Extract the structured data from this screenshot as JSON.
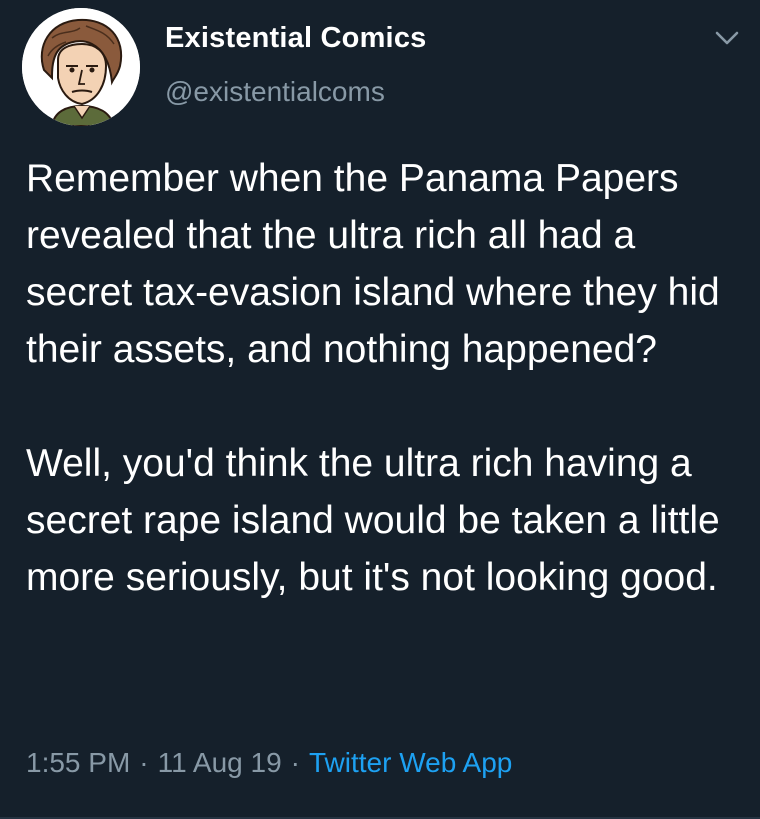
{
  "author": {
    "display_name": "Existential Comics",
    "handle": "@existentialcoms",
    "avatar_icon": "cartoon-portrait-avatar"
  },
  "tweet": {
    "paragraphs": [
      "Remember when the Panama Papers revealed that the ultra rich all had a secret tax-evasion island where they hid their assets, and nothing happened?",
      "Well, you'd think the ultra rich having a secret rape island would be taken a little more seriously, but it's not looking good."
    ]
  },
  "meta": {
    "time": "1:55 PM",
    "separator": "·",
    "date": "11 Aug 19",
    "source": "Twitter Web App"
  },
  "colors": {
    "background": "#15202b",
    "secondary_text": "#8899a6",
    "link": "#1da1f2"
  },
  "icons": {
    "menu": "chevron-down-icon"
  }
}
